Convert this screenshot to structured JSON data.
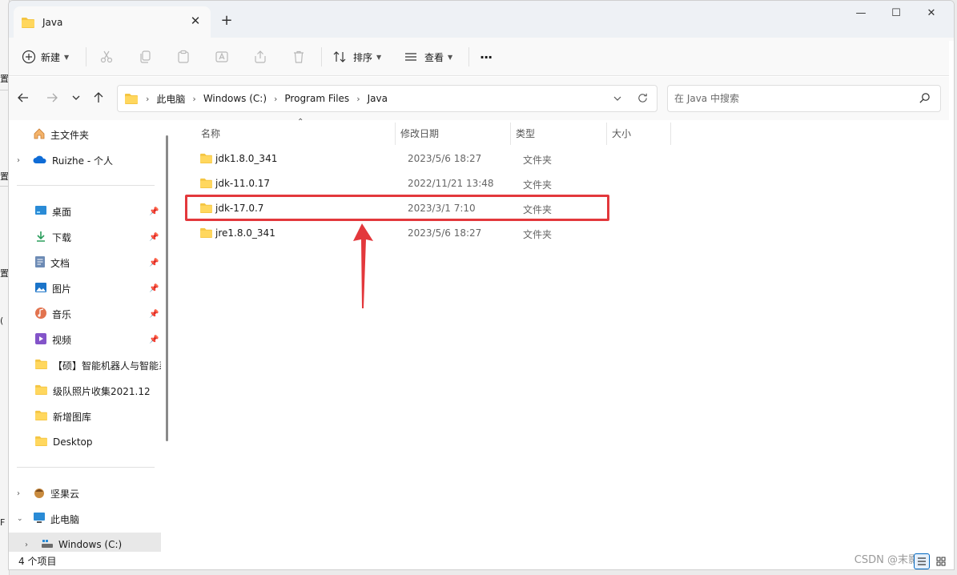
{
  "tab": {
    "title": "Java",
    "close_glyph": "✕",
    "new_glyph": "+"
  },
  "window_controls": {
    "minimize": "—",
    "maximize": "☐",
    "close": "✕"
  },
  "toolbar": {
    "new_label": "新建",
    "sort_label": "排序",
    "view_label": "查看",
    "more_label": "···"
  },
  "address": {
    "crumbs": [
      "此电脑",
      "Windows (C:)",
      "Program Files",
      "Java"
    ],
    "search_placeholder": "在 Java 中搜索"
  },
  "sidebar": {
    "items": [
      {
        "label": "主文件夹",
        "icon": "home-icon"
      },
      {
        "label": "Ruizhe - 个人",
        "icon": "onedrive-icon"
      },
      {
        "label": "桌面",
        "icon": "desktop-icon"
      },
      {
        "label": "下载",
        "icon": "download-icon"
      },
      {
        "label": "文档",
        "icon": "document-icon"
      },
      {
        "label": "图片",
        "icon": "picture-icon"
      },
      {
        "label": "音乐",
        "icon": "music-icon"
      },
      {
        "label": "视频",
        "icon": "video-icon"
      },
      {
        "label": "【硕】智能机器人与智能系",
        "icon": "folder-icon"
      },
      {
        "label": "级队照片收集2021.12",
        "icon": "folder-icon"
      },
      {
        "label": "新增图库",
        "icon": "folder-icon"
      },
      {
        "label": "Desktop",
        "icon": "folder-icon"
      },
      {
        "label": "坚果云",
        "icon": "nutstore-icon"
      },
      {
        "label": "此电脑",
        "icon": "computer-icon"
      },
      {
        "label": "Windows (C:)",
        "icon": "drive-icon"
      }
    ]
  },
  "columns": {
    "name": "名称",
    "date": "修改日期",
    "type": "类型",
    "size": "大小"
  },
  "files": [
    {
      "name": "jdk1.8.0_341",
      "date": "2023/5/6 18:27",
      "type": "文件夹"
    },
    {
      "name": "jdk-11.0.17",
      "date": "2022/11/21 13:48",
      "type": "文件夹"
    },
    {
      "name": "jdk-17.0.7",
      "date": "2023/3/1 7:10",
      "type": "文件夹"
    },
    {
      "name": "jre1.8.0_341",
      "date": "2023/5/6 18:27",
      "type": "文件夹"
    }
  ],
  "status": {
    "count": "4 个项目"
  },
  "watermark": "CSDN @末影",
  "colors": {
    "highlight": "#e3383c",
    "folder": "#f4c543",
    "accent": "#0067c0"
  }
}
